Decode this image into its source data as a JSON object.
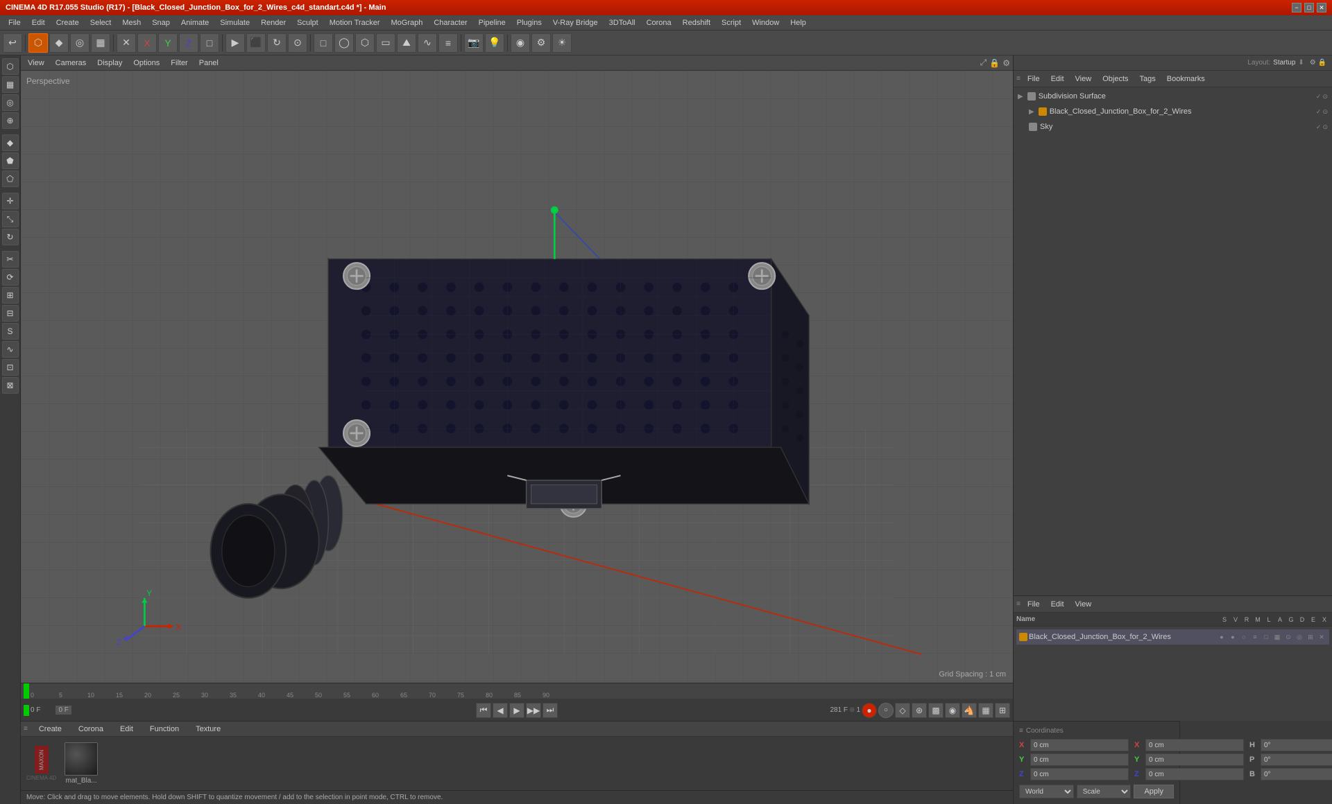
{
  "titleBar": {
    "text": "CINEMA 4D R17.055 Studio (R17) - [Black_Closed_Junction_Box_for_2_Wires_c4d_standart.c4d *] - Main",
    "minimizeLabel": "−",
    "maximizeLabel": "□",
    "closeLabel": "✕"
  },
  "menuBar": {
    "items": [
      "File",
      "Edit",
      "Create",
      "Select",
      "Mesh",
      "Snap",
      "Animate",
      "Simulate",
      "Render",
      "Sculpt",
      "Motion Tracker",
      "MoGraph",
      "Character",
      "Pipeline",
      "Plugins",
      "V-Ray Bridge",
      "3DToAll",
      "Corona",
      "Redshift",
      "Script",
      "Window",
      "Help"
    ]
  },
  "toolbar": {
    "groups": [
      {
        "icons": [
          "↩",
          "⬚",
          "⊕",
          "◉",
          "⊕",
          "✕",
          "Y",
          "Z",
          "□",
          "▶",
          "⬛",
          "↻",
          "⊙",
          "✦",
          "▦",
          "⬡",
          "◯",
          "✦",
          "⬡"
        ]
      },
      {
        "icons": [
          "▶",
          "▶▶",
          "⏸",
          "⏹",
          "⏮",
          "⏭"
        ]
      },
      {
        "icons": [
          "☀",
          "⚙",
          "🔵"
        ]
      }
    ]
  },
  "leftSidebar": {
    "icons": [
      "⬡",
      "▦",
      "◎",
      "⊞",
      "◫",
      "⬟",
      "⬠",
      "△",
      "⊿",
      "⊙",
      "⊕",
      "✂",
      "〇",
      "◎",
      "◉",
      "⟲",
      "∿",
      "⊡",
      "⊠"
    ]
  },
  "viewport": {
    "label": "Perspective",
    "menuItems": [
      "View",
      "Cameras",
      "Display",
      "Options",
      "Filter",
      "Panel"
    ],
    "gridSpacing": "Grid Spacing : 1 cm"
  },
  "scenePanel": {
    "toolbarItems": [
      "File",
      "Edit",
      "View",
      "Objects",
      "Tags",
      "Bookmarks"
    ],
    "headerLabel": "Layout:",
    "headerValue": "Startup",
    "objects": [
      {
        "label": "Subdivision Surface",
        "indent": 0,
        "color": "#888888",
        "hasIcon": true
      },
      {
        "label": "Black_Closed_Junction_Box_for_2_Wires",
        "indent": 1,
        "color": "#cc8800",
        "hasIcon": true
      },
      {
        "label": "Sky",
        "indent": 1,
        "color": "#888888",
        "hasIcon": true
      }
    ]
  },
  "attrPanel": {
    "toolbarItems": [
      "File",
      "Edit",
      "View"
    ],
    "columns": [
      "Name",
      "S",
      "V",
      "R",
      "M",
      "L",
      "A",
      "G",
      "D",
      "E",
      "X"
    ],
    "objects": [
      {
        "label": "Black_Closed_Junction_Box_for_2_Wires",
        "color": "#cc8800"
      }
    ]
  },
  "timeline": {
    "startFrame": "0 F",
    "endFrame": "281 F",
    "currentFrame": "0 F",
    "frameRate": "1",
    "markers": [
      "0",
      "5",
      "10",
      "15",
      "20",
      "25",
      "30",
      "35",
      "40",
      "45",
      "50",
      "55",
      "60",
      "65",
      "70",
      "75",
      "80",
      "85",
      "90"
    ]
  },
  "materialBar": {
    "tabs": [
      "Create",
      "Corona",
      "Edit",
      "Function",
      "Texture"
    ],
    "materials": [
      {
        "label": "mat_Bla...",
        "color": "#222222"
      }
    ]
  },
  "coordinates": {
    "xPos": "0 cm",
    "yPos": "0 cm",
    "zPos": "0 cm",
    "xSize": "0 cm",
    "ySize": "0 cm",
    "zSize": "0 cm",
    "hRot": "0°",
    "pRot": "0°",
    "bRot": "0°",
    "worldLabel": "World",
    "scaleLabel": "Scale",
    "applyLabel": "Apply"
  },
  "statusBar": {
    "text": "Move: Click and drag to move elements. Hold down SHIFT to quantize movement / add to the selection in point mode, CTRL to remove."
  }
}
